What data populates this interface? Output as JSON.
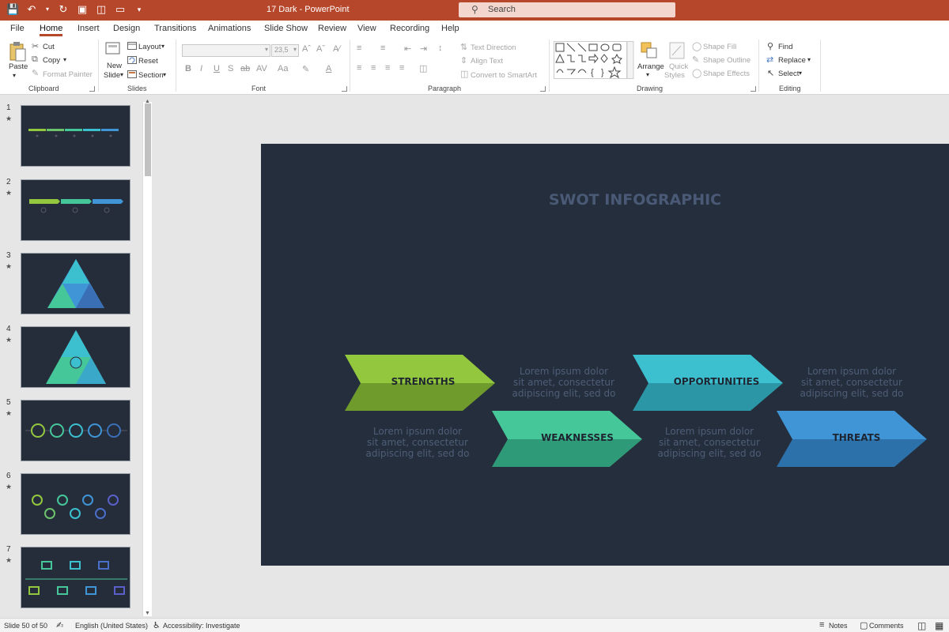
{
  "window": {
    "title": "17 Dark  -  PowerPoint",
    "search_placeholder": "Search"
  },
  "tabs": [
    "File",
    "Home",
    "Insert",
    "Design",
    "Transitions",
    "Animations",
    "Slide Show",
    "Review",
    "View",
    "Recording",
    "Help"
  ],
  "active_tab": "Home",
  "ribbon": {
    "clipboard": {
      "paste": "Paste",
      "cut": "Cut",
      "copy": "Copy",
      "format_painter": "Format Painter",
      "label": "Clipboard"
    },
    "slides": {
      "new_slide_1": "New",
      "new_slide_2": "Slide",
      "layout": "Layout",
      "reset": "Reset",
      "section": "Section",
      "label": "Slides"
    },
    "font": {
      "size": "23,5",
      "label": "Font"
    },
    "paragraph": {
      "text_direction": "Text Direction",
      "align_text": "Align Text",
      "convert_smartart": "Convert to SmartArt",
      "label": "Paragraph"
    },
    "drawing": {
      "arrange": "Arrange",
      "quick_styles_1": "Quick",
      "quick_styles_2": "Styles",
      "shape_fill": "Shape Fill",
      "shape_outline": "Shape Outline",
      "shape_effects": "Shape Effects",
      "label": "Drawing"
    },
    "editing": {
      "find": "Find",
      "replace": "Replace",
      "select": "Select",
      "label": "Editing"
    }
  },
  "slides_panel": {
    "numbers": [
      "1",
      "2",
      "3",
      "4",
      "5",
      "6",
      "7"
    ]
  },
  "slide": {
    "title": "SWOT INFOGRAPHIC",
    "items": [
      {
        "label": "STRENGTHS",
        "color_top": "#93c83e",
        "color_bottom": "#6f9a2c"
      },
      {
        "label": "WEAKNESSES",
        "color_top": "#45c79a",
        "color_bottom": "#2f9a77"
      },
      {
        "label": "OPPORTUNITIES",
        "color_top": "#3cbfcf",
        "color_bottom": "#2b97a6"
      },
      {
        "label": "THREATS",
        "color_top": "#3f95d6",
        "color_bottom": "#2d71aa"
      }
    ],
    "lorem_1": "Lorem ipsum dolor",
    "lorem_2": "sit amet, consectetur",
    "lorem_3": "adipiscing elit, sed do"
  },
  "status": {
    "slide_count": "Slide 50 of 50",
    "language": "English (United States)",
    "accessibility": "Accessibility: Investigate",
    "notes": "Notes",
    "comments": "Comments"
  }
}
